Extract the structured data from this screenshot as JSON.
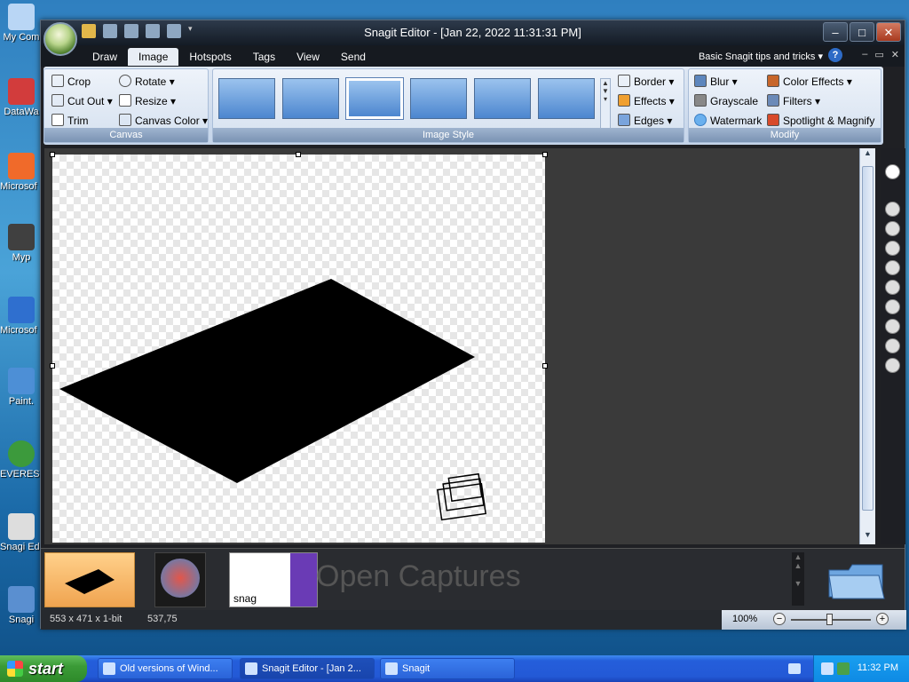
{
  "desktop": {
    "icons": [
      {
        "label": "My Com",
        "color": "#b9d6f5"
      },
      {
        "label": "DataWa",
        "color": "#d23c3c"
      },
      {
        "label": "Microsof C++",
        "color": "#f06a2a"
      },
      {
        "label": "Myp",
        "color": "#404040"
      },
      {
        "label": "Microsof Basic",
        "color": "#2f6fcf"
      },
      {
        "label": "Paint.",
        "color": "#4d8fd6"
      },
      {
        "label": "EVEREST Editi",
        "color": "#3c9a3c"
      },
      {
        "label": "Snagi Edit",
        "color": "#dddddd"
      },
      {
        "label": "Snagi",
        "color": "#5a8fd0"
      }
    ]
  },
  "window": {
    "title": "Snagit Editor - [Jan 22, 2022 11:31:31 PM]",
    "tabs": [
      "Draw",
      "Image",
      "Hotspots",
      "Tags",
      "View",
      "Send"
    ],
    "active_tab": "Image",
    "tips_label": "Basic Snagit tips and tricks",
    "help_label": "?"
  },
  "ribbon": {
    "canvas": {
      "label": "Canvas",
      "crop": "Crop",
      "cut_out": "Cut Out",
      "trim": "Trim",
      "rotate": "Rotate",
      "resize": "Resize",
      "canvas_color": "Canvas Color"
    },
    "image_style": {
      "label": "Image Style",
      "border": "Border",
      "effects": "Effects",
      "edges": "Edges"
    },
    "modify": {
      "label": "Modify",
      "blur": "Blur",
      "grayscale": "Grayscale",
      "watermark": "Watermark",
      "color_effects": "Color Effects",
      "filters": "Filters",
      "spotlight": "Spotlight & Magnify"
    }
  },
  "tray": {
    "label": "Open Captures",
    "snag_label": "snag"
  },
  "status": {
    "dimensions": "553 x 471 x 1-bit",
    "coords": "537,75",
    "zoom": "100%"
  },
  "taskbar": {
    "start": "start",
    "tasks": [
      {
        "label": "Old versions of Wind..."
      },
      {
        "label": "Snagit Editor - [Jan 2..."
      },
      {
        "label": "Snagit"
      }
    ],
    "clock": "11:32 PM"
  },
  "colors": {
    "accent": "#2e6bc6",
    "canvas_shape": "#000000"
  }
}
